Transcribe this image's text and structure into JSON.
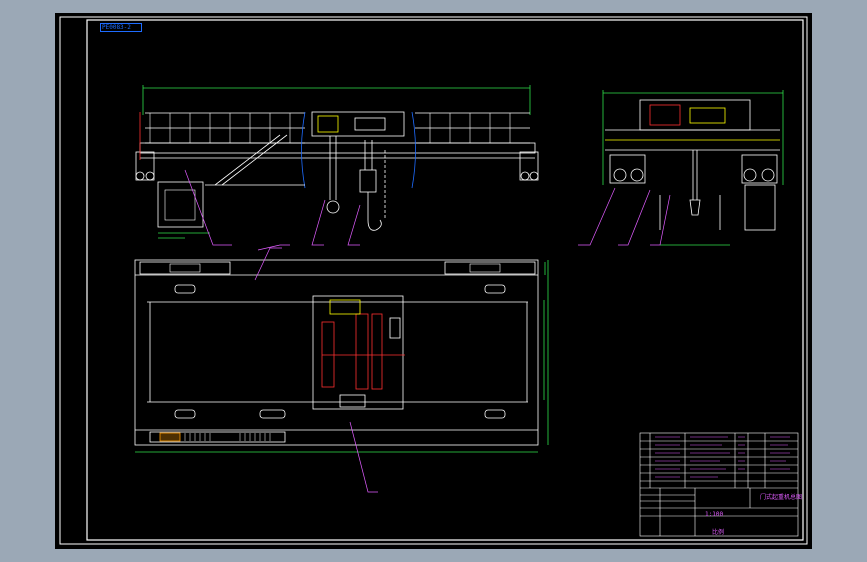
{
  "window": {
    "background": "#9ba8b6",
    "viewport_background": "#000000"
  },
  "drawing": {
    "corner_tag": "PE0083-2",
    "title_block": {
      "drawing_name": "门式起重机总图",
      "scale_label": "1:100",
      "material_label": "比例"
    },
    "colors": {
      "frame": "#ffffff",
      "outline": "#ffffff",
      "dimension": "#2fe04a",
      "leader": "#ff3030",
      "highlight": "#ffff00",
      "annotation": "#e05cff",
      "border_inner": "#ffffff"
    },
    "icons": [
      "crane-elevation-view",
      "crane-side-view",
      "crane-plan-view",
      "title-block-table"
    ]
  }
}
